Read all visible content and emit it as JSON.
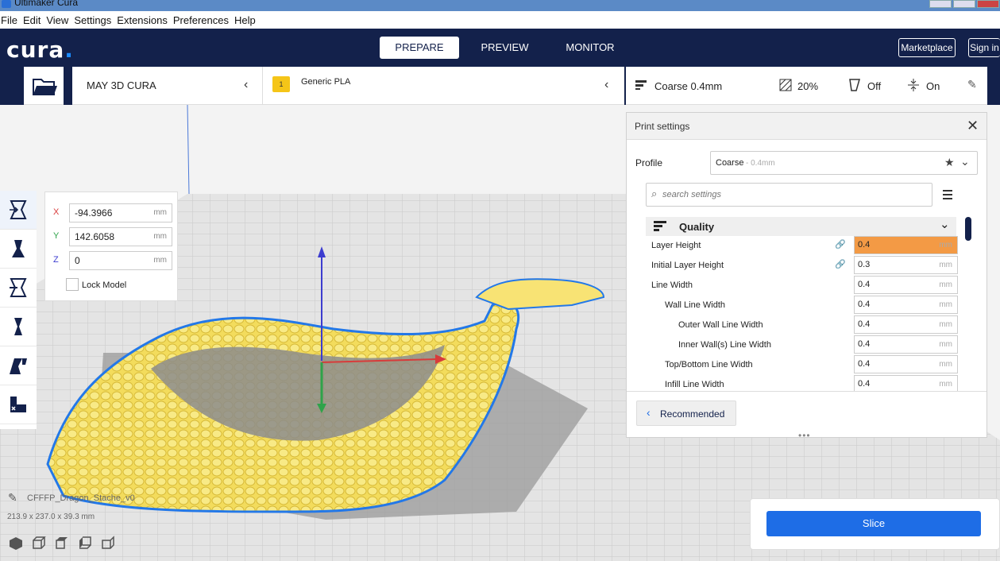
{
  "window": {
    "title": "Ultimaker Cura"
  },
  "menu": [
    "File",
    "Edit",
    "View",
    "Settings",
    "Extensions",
    "Preferences",
    "Help"
  ],
  "header": {
    "logo": "cura",
    "logo_dot": ".",
    "stages": [
      "PREPARE",
      "PREVIEW",
      "MONITOR"
    ],
    "marketplace": "Marketplace",
    "signin": "Sign in"
  },
  "machine": {
    "name": "MAY 3D CURA"
  },
  "material": {
    "badge": "1",
    "name": "Generic PLA"
  },
  "settings_bar": {
    "profile": "Coarse 0.4mm",
    "infill": "20%",
    "support": "Off",
    "adhesion": "On"
  },
  "move_panel": {
    "x_label": "X",
    "x": "-94.3966",
    "y_label": "Y",
    "y": "142.6058",
    "z_label": "Z",
    "z": "0",
    "unit": "mm",
    "lock": "Lock Model"
  },
  "print_settings": {
    "title": "Print settings",
    "profile_label": "Profile",
    "profile_value": "Coarse",
    "profile_suffix": "- 0.4mm",
    "search_placeholder": "search settings",
    "category": "Quality",
    "rows": [
      {
        "label": "Layer Height",
        "value": "0.4",
        "linked": true,
        "indent": 0,
        "highlight": true
      },
      {
        "label": "Initial Layer Height",
        "value": "0.3",
        "linked": true,
        "indent": 0
      },
      {
        "label": "Line Width",
        "value": "0.4",
        "indent": 0
      },
      {
        "label": "Wall Line Width",
        "value": "0.4",
        "indent": 1
      },
      {
        "label": "Outer Wall Line Width",
        "value": "0.4",
        "indent": 2
      },
      {
        "label": "Inner Wall(s) Line Width",
        "value": "0.4",
        "indent": 2
      },
      {
        "label": "Top/Bottom Line Width",
        "value": "0.4",
        "indent": 1
      },
      {
        "label": "Infill Line Width",
        "value": "0.4",
        "indent": 1
      }
    ],
    "unit": "mm",
    "recommended": "Recommended"
  },
  "object": {
    "name": "CFFFP_Dragon_Stache_v0",
    "dims": "213.9 x 237.0 x 39.3 mm"
  },
  "slice": {
    "label": "Slice"
  },
  "colors": {
    "header": "#13214b",
    "accent": "#1e6de6",
    "model": "#f5e06a",
    "outline": "#2378e8",
    "highlight": "#f39a45"
  }
}
